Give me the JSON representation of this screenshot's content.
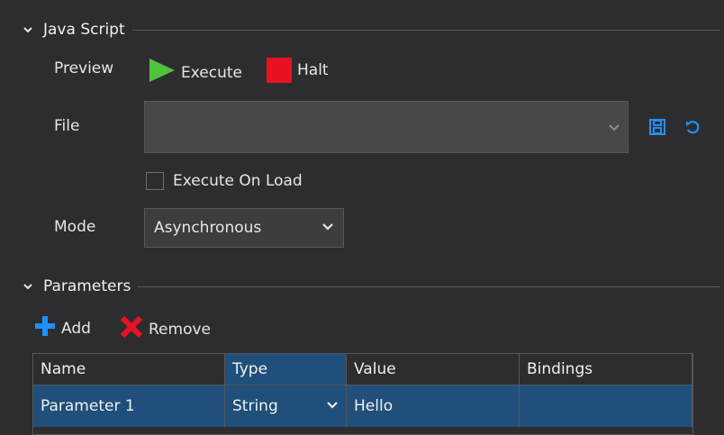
{
  "javascript_section": {
    "title": "Java Script",
    "preview_label": "Preview",
    "execute_label": "Execute",
    "halt_label": "Halt",
    "file_label": "File",
    "file_value": "",
    "execute_on_load_label": "Execute On Load",
    "execute_on_load_checked": false,
    "mode_label": "Mode",
    "mode_value": "Asynchronous"
  },
  "parameters_section": {
    "title": "Parameters",
    "add_label": "Add",
    "remove_label": "Remove",
    "columns": [
      "Name",
      "Type",
      "Value",
      "Bindings"
    ],
    "rows": [
      {
        "name": "Parameter 1",
        "type": "String",
        "value": "Hello",
        "bindings": ""
      }
    ]
  },
  "colors": {
    "background": "#2d2d30",
    "selection": "#1f4f7a",
    "execute_green": "#4fc33b",
    "halt_red": "#e81123",
    "accent_blue": "#1e90ff"
  }
}
